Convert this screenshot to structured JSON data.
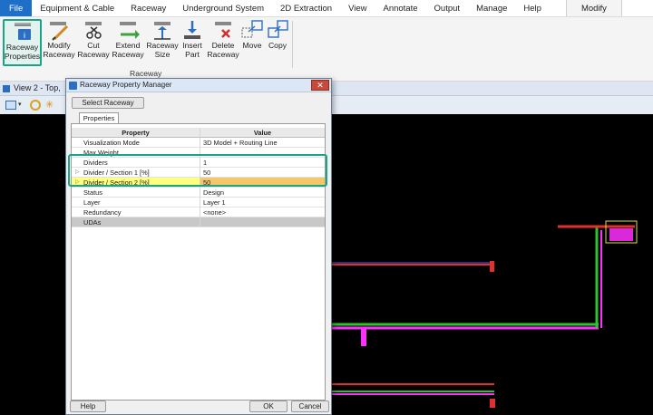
{
  "menu": {
    "file": "File",
    "items": [
      "Equipment & Cable",
      "Raceway",
      "Underground System",
      "2D Extraction",
      "View",
      "Annotate",
      "Output",
      "Manage",
      "Help"
    ],
    "active": "Modify"
  },
  "ribbon": {
    "buttons": [
      {
        "label": "Raceway\nProperties",
        "icon": "raceway-properties-icon",
        "selected": true
      },
      {
        "label": "Modify\nRaceway",
        "icon": "modify-raceway-icon"
      },
      {
        "label": "Cut\nRaceway",
        "icon": "cut-raceway-icon"
      },
      {
        "label": "Extend\nRaceway",
        "icon": "extend-raceway-icon"
      },
      {
        "label": "Raceway\nSize",
        "icon": "raceway-size-icon"
      },
      {
        "label": "Insert\nPart",
        "icon": "insert-part-icon"
      },
      {
        "label": "Delete\nRaceway",
        "icon": "delete-raceway-icon"
      },
      {
        "label": "Move",
        "icon": "move-icon"
      },
      {
        "label": "Copy",
        "icon": "copy-icon"
      }
    ],
    "group_label": "Raceway"
  },
  "view": {
    "title": "View 2 - Top,"
  },
  "dialog": {
    "title": "Raceway Property Manager",
    "close": "✕",
    "select_button": "Select Raceway",
    "tab": "Properties",
    "columns": [
      "Property",
      "Value"
    ],
    "rows": [
      {
        "property": "Visualization Mode",
        "value": "3D Model + Routing Line"
      },
      {
        "property": "Max Weight",
        "value": ""
      },
      {
        "property": "Dividers",
        "value": "1"
      },
      {
        "property": "Divider / Section 1 [%]",
        "value": "50",
        "arrow": true
      },
      {
        "property": "Divider / Section 2 [%]",
        "value": "50",
        "arrow": true,
        "highlight": true
      },
      {
        "property": "Status",
        "value": "Design"
      },
      {
        "property": "Layer",
        "value": "Layer 1"
      },
      {
        "property": "Redundancy",
        "value": "<none>"
      },
      {
        "property": "UDAs",
        "value": "",
        "group": true
      }
    ],
    "help": "Help",
    "ok": "OK",
    "cancel": "Cancel"
  },
  "colors": {
    "accent": "#19a488",
    "file_menu": "#1e6fc7",
    "highlight_cell": "#ffff80",
    "highlight_value": "#f4c86a"
  }
}
